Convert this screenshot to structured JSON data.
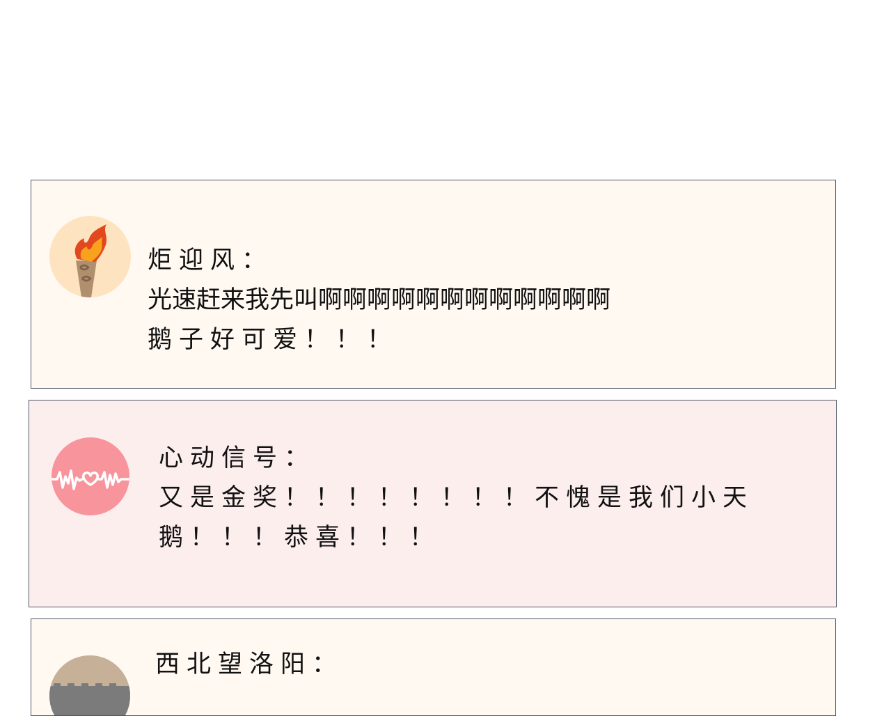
{
  "comments": [
    {
      "username": "炬迎风：",
      "avatar_icon": "torch-icon",
      "background": "#fff9f2",
      "lines": [
        "光速赶来我先叫啊啊啊啊啊啊啊啊啊啊啊啊",
        "鹅子好可爱！！！"
      ]
    },
    {
      "username": "心动信号：",
      "avatar_icon": "heartbeat-icon",
      "background": "#fdeeee",
      "lines": [
        "又是金奖！！！！！！！！不愧是我们小天",
        "鹅！！！恭喜！！！"
      ]
    },
    {
      "username": "西北望洛阳：",
      "avatar_icon": "city-wall-icon",
      "background": "#fff9f2",
      "lines": []
    }
  ]
}
